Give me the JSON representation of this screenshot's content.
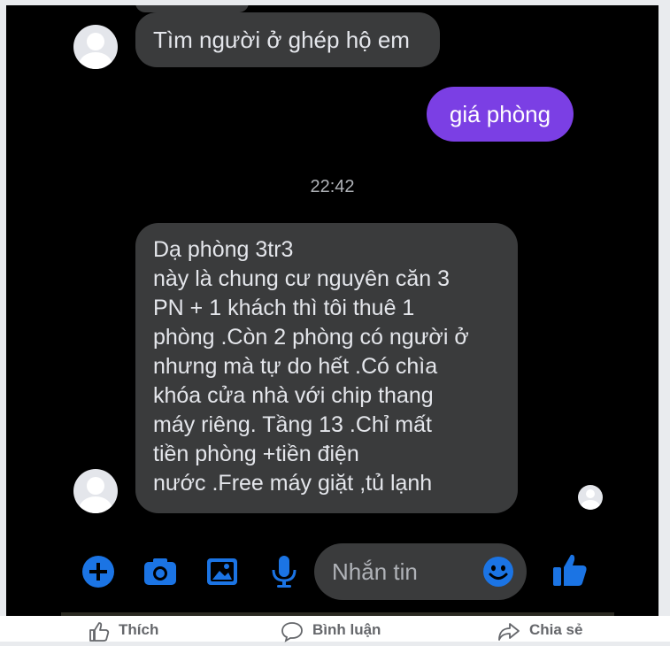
{
  "chat": {
    "incoming_1": "Tìm người ở ghép hộ em",
    "outgoing_1": "giá phòng",
    "timestamp": "22:42",
    "incoming_2_lines": [
      "Dạ phòng 3tr3",
      "này là chung cư nguyên căn 3",
      "PN + 1 khách thì tôi thuê 1",
      "phòng .Còn 2 phòng có người ở",
      "nhưng mà tự do hết .Có chìa",
      "khóa cửa nhà với chip thang",
      "máy riêng. Tầng 13 .Chỉ mất",
      "tiền phòng +tiền điện",
      "nước .Free máy giặt ,tủ lạnh"
    ]
  },
  "composer": {
    "placeholder": "Nhắn tin",
    "icons": [
      "plus-icon",
      "camera-icon",
      "image-icon",
      "microphone-icon",
      "emoji-icon",
      "thumbs-up-icon"
    ]
  },
  "post_actions": {
    "like": "Thích",
    "comment": "Bình luận",
    "share": "Chia sẻ"
  },
  "colors": {
    "background": "#000000",
    "incoming_bubble": "#3a3b3c",
    "outgoing_bubble": "#7b3fe4",
    "accent": "#1b74e4"
  }
}
